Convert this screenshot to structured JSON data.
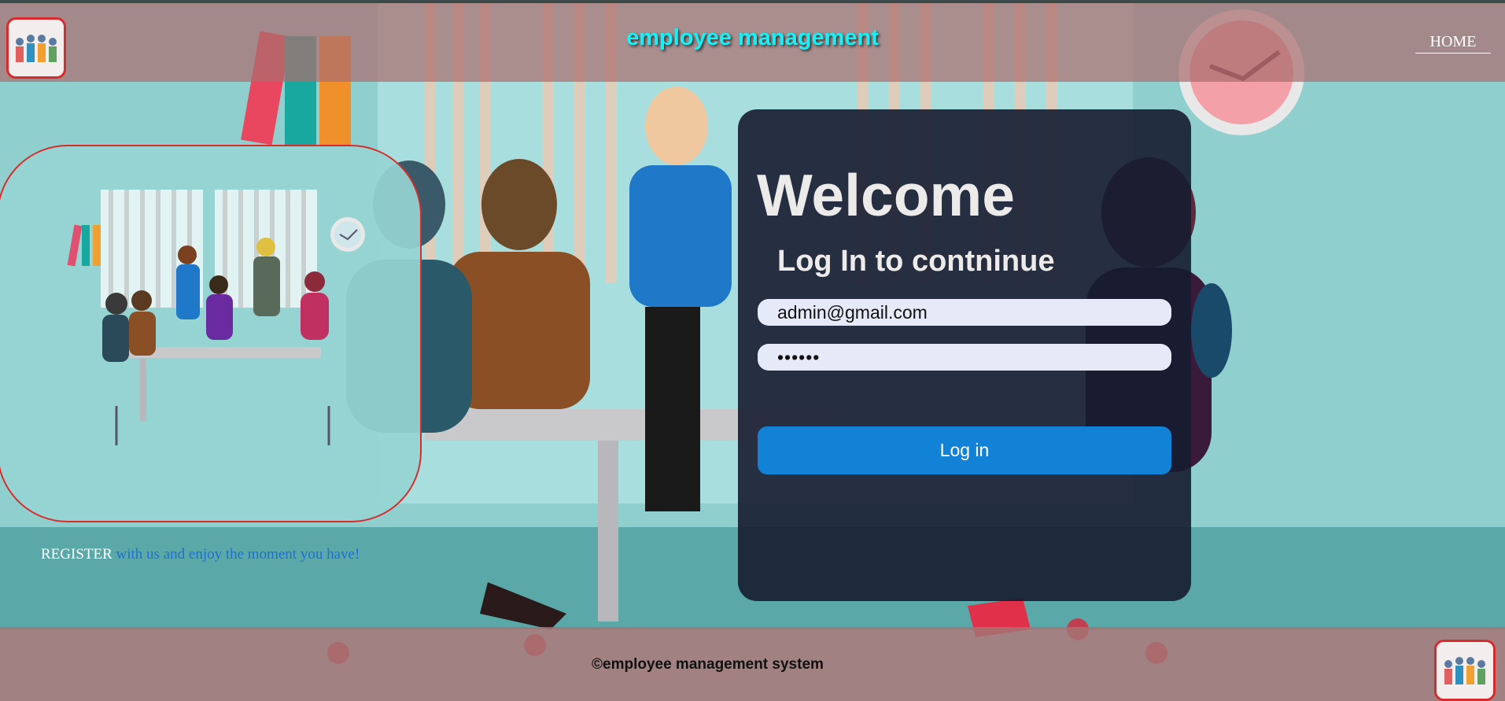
{
  "header": {
    "title": "employee management",
    "nav_home": "HOME",
    "logo_icon": "team-logo-icon"
  },
  "promo": {
    "image_icon": "office-team-illustration",
    "register_link": "REGISTER",
    "register_text": " with us and enjoy the moment you have!"
  },
  "login": {
    "welcome": "Welcome",
    "subtitle": "Log In to contninue",
    "email_value": "admin@gmail.com",
    "password_value": "••••••",
    "button_label": "Log in"
  },
  "footer": {
    "copyright": "©employee management system"
  },
  "colors": {
    "title": "#18f0f5",
    "button": "#1282d6",
    "card": "#161c30",
    "accent_border": "#d92b2b"
  }
}
